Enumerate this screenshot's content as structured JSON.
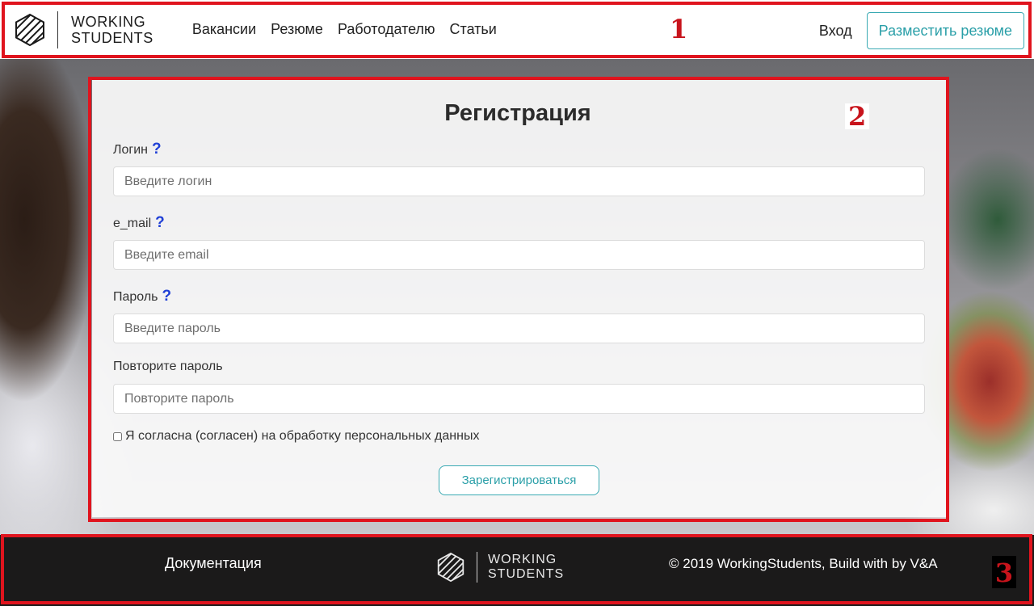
{
  "brand": {
    "line1": "WORKING",
    "line2": "STUDENTS"
  },
  "header": {
    "nav": [
      "Вакансии",
      "Резюме",
      "Работодателю",
      "Статьи"
    ],
    "login": "Вход",
    "post_resume": "Разместить резюме"
  },
  "form": {
    "title": "Регистрация",
    "help_glyph": "?",
    "fields": [
      {
        "label": "Логин",
        "placeholder": "Введите логин",
        "value": ""
      },
      {
        "label": "e_mail",
        "placeholder": "Введите email",
        "value": ""
      },
      {
        "label": "Пароль",
        "placeholder": "Введите пароль",
        "value": ""
      },
      {
        "label": "Повторите пароль",
        "placeholder": "Повторите пароль",
        "value": ""
      }
    ],
    "consent": "Я согласна (согласен) на обработку персональных данных",
    "consent_checked": false,
    "submit": "Зарегистрироваться"
  },
  "footer": {
    "docs": "Документация",
    "copyright": "© 2019 WorkingStudents, Build with by V&A"
  },
  "annotations": {
    "a1": "1",
    "a2": "2",
    "a3": "3"
  },
  "colors": {
    "accent": "#3aaab3",
    "help": "#1f3fd6",
    "annotation": "#e0141e",
    "footer_bg": "#1b1a1a"
  }
}
